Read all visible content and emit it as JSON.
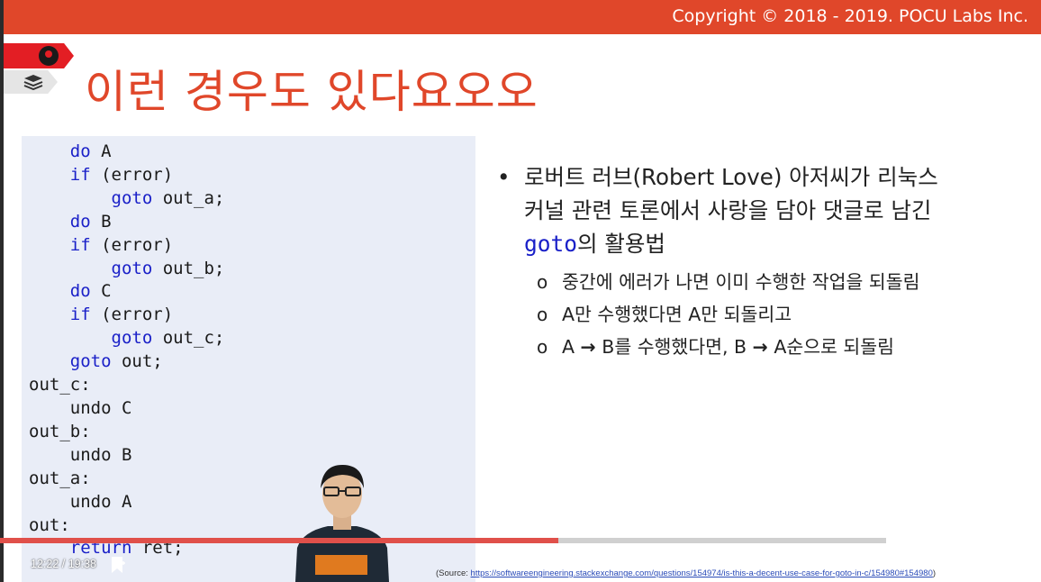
{
  "header": {
    "copyright": "Copyright © 2018 - 2019. POCU Labs Inc."
  },
  "slide": {
    "title": "이런 경우도 있다요오오",
    "code_lines": [
      [
        {
          "t": "    "
        },
        {
          "t": "do",
          "kw": true
        },
        {
          "t": " A"
        }
      ],
      [
        {
          "t": "    "
        },
        {
          "t": "if",
          "kw": true
        },
        {
          "t": " (error)"
        }
      ],
      [
        {
          "t": "        "
        },
        {
          "t": "goto",
          "kw": true
        },
        {
          "t": " out_a;"
        }
      ],
      [
        {
          "t": "    "
        },
        {
          "t": "do",
          "kw": true
        },
        {
          "t": " B"
        }
      ],
      [
        {
          "t": "    "
        },
        {
          "t": "if",
          "kw": true
        },
        {
          "t": " (error)"
        }
      ],
      [
        {
          "t": "        "
        },
        {
          "t": "goto",
          "kw": true
        },
        {
          "t": " out_b;"
        }
      ],
      [
        {
          "t": "    "
        },
        {
          "t": "do",
          "kw": true
        },
        {
          "t": " C"
        }
      ],
      [
        {
          "t": "    "
        },
        {
          "t": "if",
          "kw": true
        },
        {
          "t": " (error)"
        }
      ],
      [
        {
          "t": "        "
        },
        {
          "t": "goto",
          "kw": true
        },
        {
          "t": " out_c;"
        }
      ],
      [
        {
          "t": "    "
        },
        {
          "t": "goto",
          "kw": true
        },
        {
          "t": " out;"
        }
      ],
      [
        {
          "t": "out_c:"
        }
      ],
      [
        {
          "t": "    undo C"
        }
      ],
      [
        {
          "t": "out_b:"
        }
      ],
      [
        {
          "t": "    undo B"
        }
      ],
      [
        {
          "t": "out_a:"
        }
      ],
      [
        {
          "t": "    undo A"
        }
      ],
      [
        {
          "t": "out:"
        }
      ],
      [
        {
          "t": "    "
        },
        {
          "t": "return",
          "kw": true
        },
        {
          "t": " ret;"
        }
      ]
    ],
    "bullet_main": {
      "dot": "•",
      "line1": "로버트 러브(Robert Love) 아저씨가 리눅스",
      "line2": "커널 관련 토론에서 사랑을 담아 댓글로 남긴",
      "goto_word": "goto",
      "line3_rest": "의 활용법"
    },
    "sub_bullets": [
      {
        "circle": "o",
        "parts": [
          "중간에 에러가 나면 이미 수행한 작업을 되돌림"
        ]
      },
      {
        "circle": "o",
        "parts": [
          "A만 수행했다면 A만 되돌리고"
        ]
      },
      {
        "circle": "o",
        "parts": [
          "A ",
          "→",
          " B를 수행했다면, B ",
          "→",
          " A순으로 되돌림"
        ]
      }
    ],
    "source_prefix": "(Source: ",
    "source_url": "https://softwareengineering.stackexchange.com/questions/154974/is-this-a-decent-use-case-for-goto-in-c/154980#154980",
    "source_suffix": ")"
  },
  "player": {
    "time": "12:22 / 19:38",
    "progress": 0.63,
    "replay_icon": "replay-icon",
    "bookmark_icon": "bookmark-icon"
  },
  "colors": {
    "brand": "#e0472a",
    "keyword": "#1a20c8",
    "code_bg": "#e9edf7",
    "progress": "#e0504a"
  }
}
